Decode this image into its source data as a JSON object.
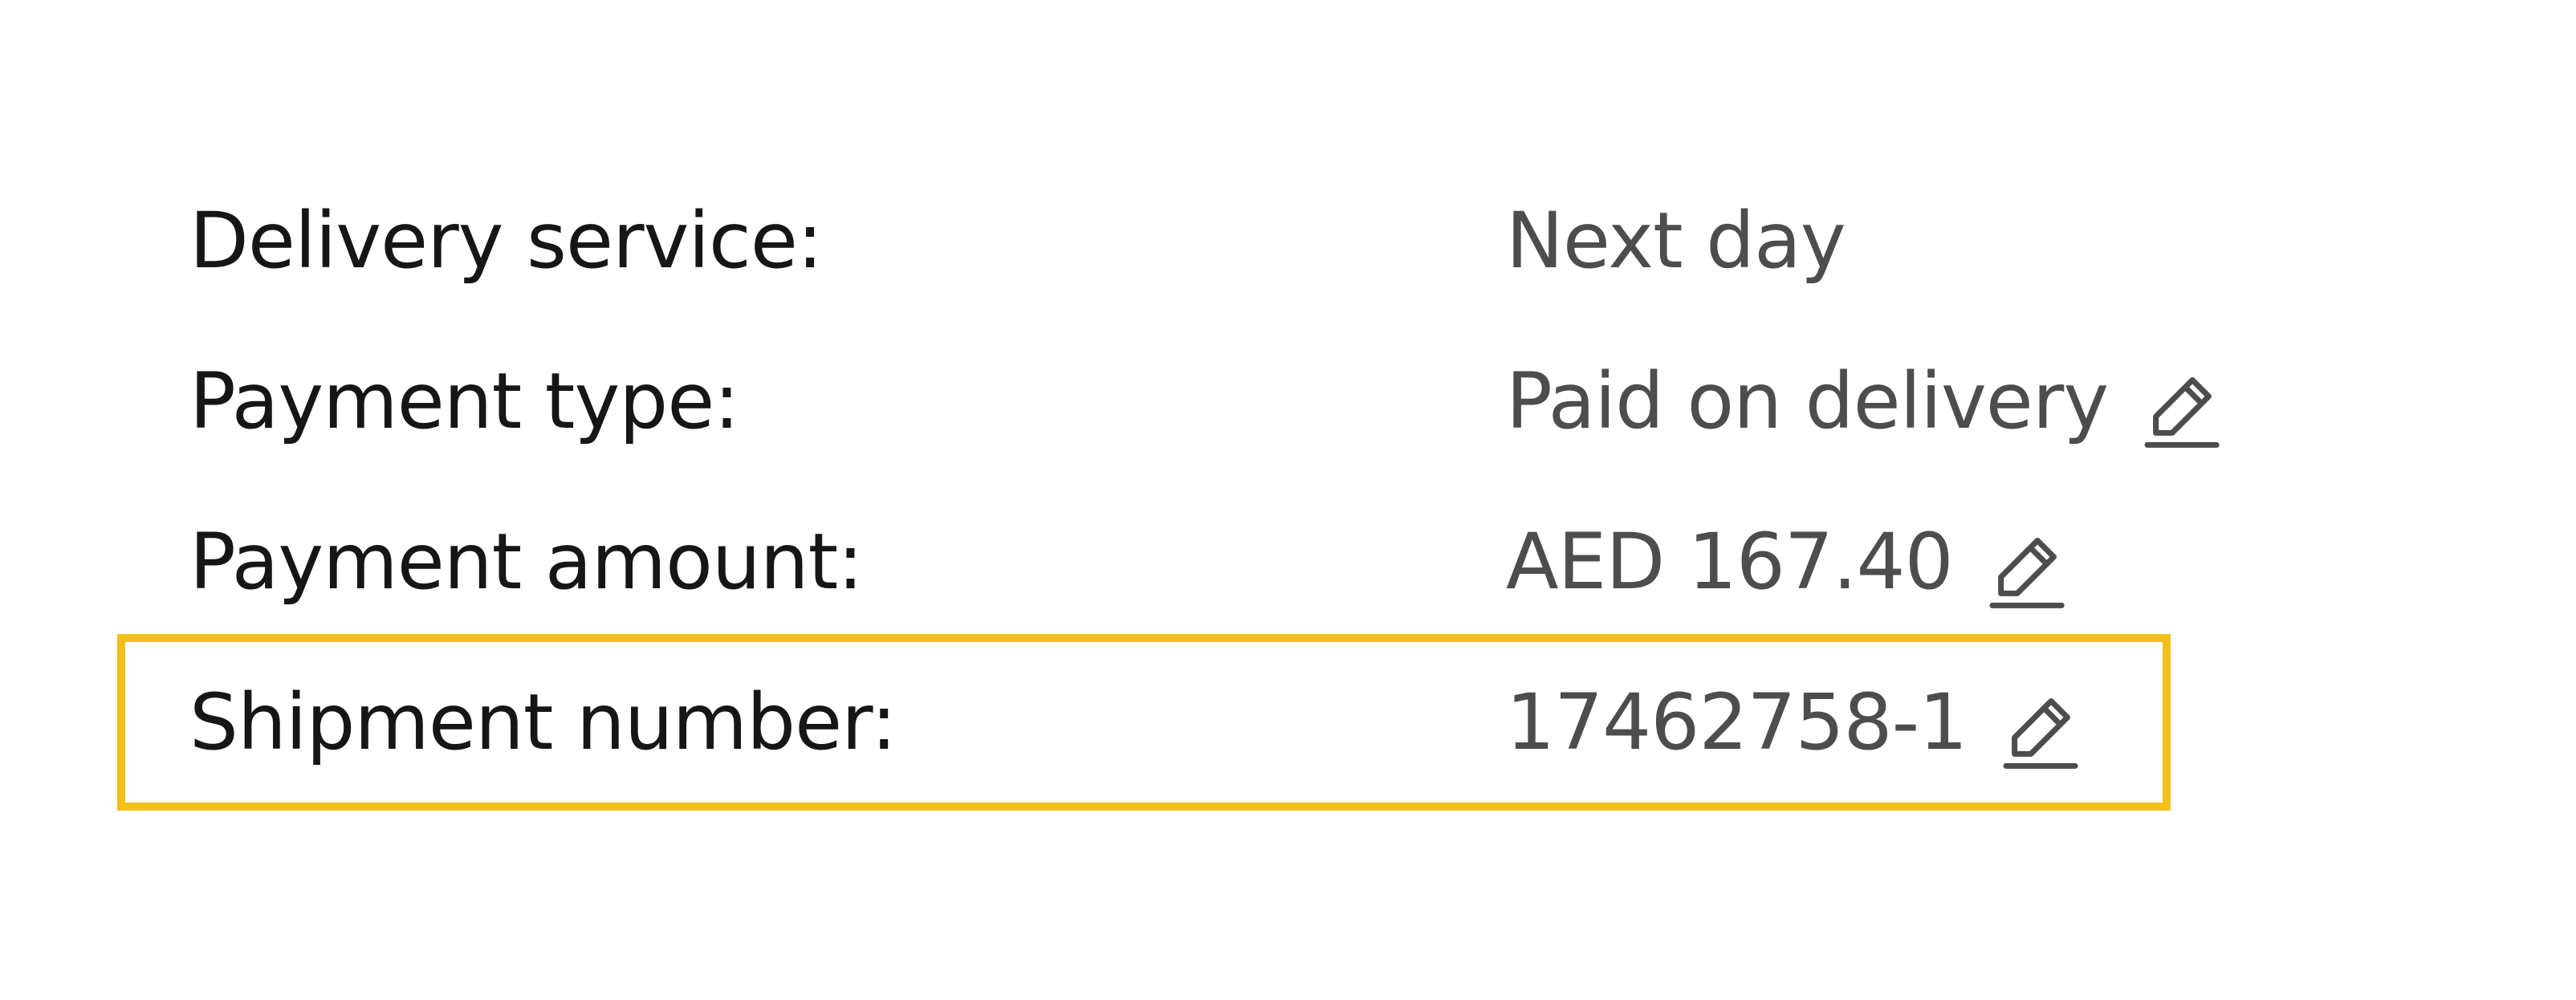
{
  "details": [
    {
      "label": "Delivery service:",
      "value": "Next day",
      "editable": false
    },
    {
      "label": "Payment type:",
      "value": "Paid on delivery",
      "editable": true,
      "icon": "pencil-icon"
    },
    {
      "label": "Payment amount:",
      "value": "AED 167.40",
      "editable": true,
      "icon": "pencil-icon"
    },
    {
      "label": "Shipment number:",
      "value": "17462758-1",
      "editable": true,
      "icon": "pencil-icon"
    }
  ],
  "highlight": {
    "row": "Shipment number:",
    "color": "#f2c018"
  }
}
